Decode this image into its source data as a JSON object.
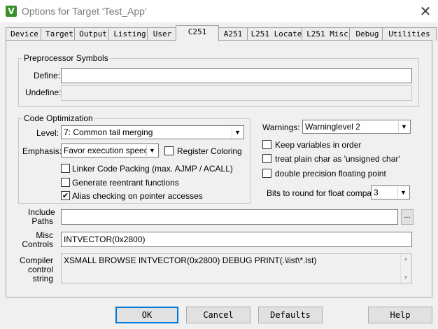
{
  "window": {
    "title": "Options for Target 'Test_App'",
    "icon_name": "keil-uvision-icon",
    "close_glyph": "✕"
  },
  "tabs": [
    {
      "label": "Device"
    },
    {
      "label": "Target"
    },
    {
      "label": "Output"
    },
    {
      "label": "Listing"
    },
    {
      "label": "User"
    },
    {
      "label": "C251"
    },
    {
      "label": "A251"
    },
    {
      "label": "L251 Locate"
    },
    {
      "label": "L251 Misc"
    },
    {
      "label": "Debug"
    },
    {
      "label": "Utilities"
    }
  ],
  "active_tab": "C251",
  "preprocessor": {
    "group_label": "Preprocessor Symbols",
    "define_label": "Define:",
    "define_value": "",
    "undefine_label": "Undefine:",
    "undefine_value": ""
  },
  "optimization": {
    "group_label": "Code Optimization",
    "level_label": "Level:",
    "level_value": "7: Common tail merging",
    "emphasis_label": "Emphasis:",
    "emphasis_value": "Favor execution speed",
    "register_coloring": {
      "label": "Register Coloring",
      "checked": false
    },
    "linker_code_packing": {
      "label": "Linker Code Packing (max. AJMP / ACALL)",
      "checked": false
    },
    "reentrant": {
      "label": "Generate reentrant functions",
      "checked": false
    },
    "alias_checking": {
      "label": "Alias checking on pointer accesses",
      "checked": true
    }
  },
  "warnings": {
    "label": "Warnings:",
    "value": "Warninglevel 2",
    "keep_variables": {
      "label": "Keep variables in order",
      "checked": false
    },
    "plain_char": {
      "label": "treat plain char as 'unsigned char'",
      "checked": false
    },
    "double_precision": {
      "label": "double precision floating point",
      "checked": false
    },
    "bits_round_label": "Bits to round for float compare:",
    "bits_round_value": "3"
  },
  "include_paths": {
    "label_line1": "Include",
    "label_line2": "Paths",
    "value": "",
    "browse_label": "..."
  },
  "misc_controls": {
    "label_line1": "Misc",
    "label_line2": "Controls",
    "value": "INTVECTOR(0x2800)"
  },
  "compiler_string": {
    "label_line1": "Compiler",
    "label_line2": "control",
    "label_line3": "string",
    "value": "XSMALL BROWSE INTVECTOR(0x2800) DEBUG PRINT(.\\list\\*.lst)"
  },
  "buttons": {
    "ok": "OK",
    "cancel": "Cancel",
    "defaults": "Defaults",
    "help": "Help"
  },
  "glyphs": {
    "check": "✔",
    "dropdown": "▼",
    "scroll_up": "▲",
    "scroll_down": "▼"
  }
}
